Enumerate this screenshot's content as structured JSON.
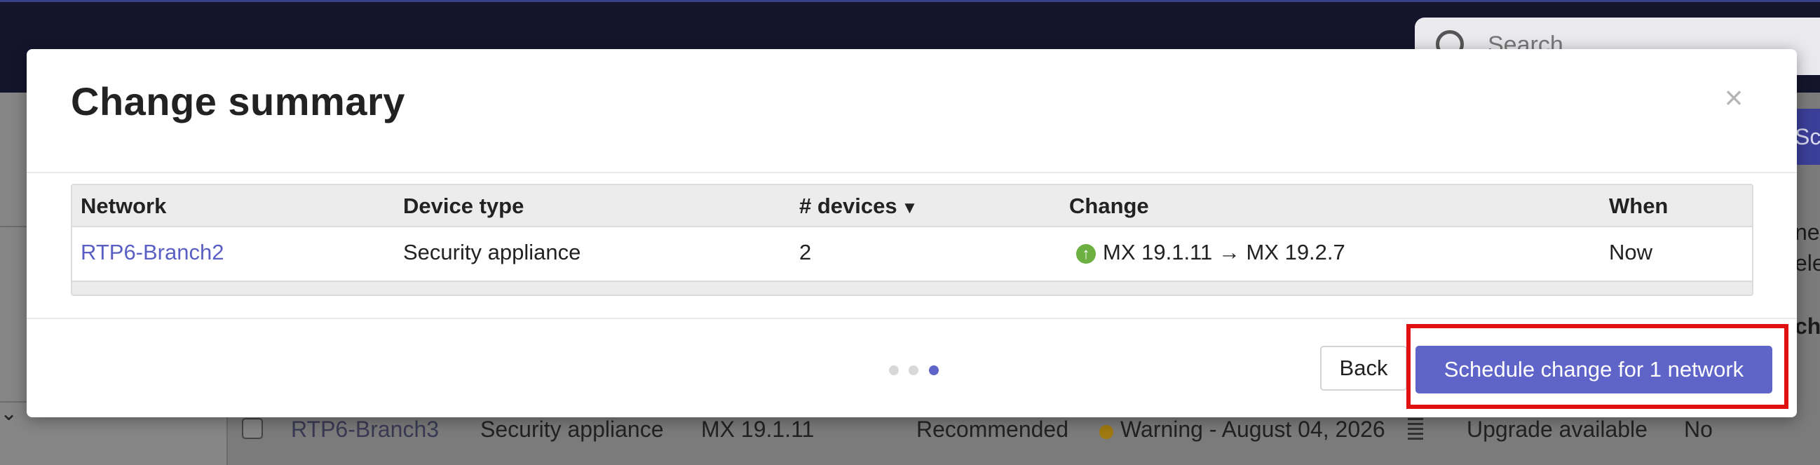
{
  "background": {
    "search": {
      "placeholder": "Search"
    },
    "right_edge_texts": [
      "Sche",
      "ne",
      "ele",
      "ch"
    ],
    "row": {
      "network": "RTP6-Branch3",
      "device_type": "Security appliance",
      "current_version": "MX 19.1.11",
      "recommendation": "Recommended",
      "status": "Warning - August 04, 2026",
      "availability": "Upgrade available",
      "flag": "No"
    }
  },
  "modal": {
    "title": "Change summary",
    "close_label": "×",
    "table": {
      "headers": {
        "network": "Network",
        "device_type": "Device type",
        "devices": "# devices",
        "change": "Change",
        "when": "When"
      },
      "sort_indicator": "▼",
      "rows": [
        {
          "network": "RTP6-Branch2",
          "device_type": "Security appliance",
          "devices": "2",
          "change": "MX 19.1.11 → MX 19.2.7",
          "when": "Now"
        }
      ]
    },
    "pager": {
      "total": 3,
      "current": 3
    },
    "buttons": {
      "back": "Back",
      "schedule": "Schedule change for 1 network"
    }
  },
  "colors": {
    "accent": "#5f64c9",
    "link": "#5a5fc4",
    "upgrade_icon": "#6cb042",
    "highlight": "#e01010"
  }
}
